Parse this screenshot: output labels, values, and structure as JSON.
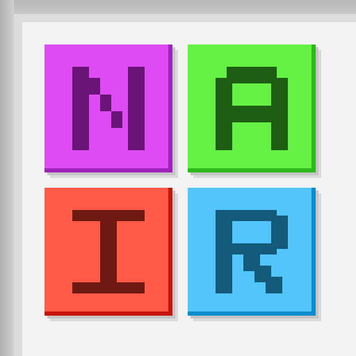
{
  "tiles": [
    {
      "letter": "N",
      "color": "#dc4cf2",
      "edge": "#a022b8",
      "glyph_color": "#6a1478"
    },
    {
      "letter": "A",
      "color": "#66f244",
      "edge": "#2eb81a",
      "glyph_color": "#1d5e14"
    },
    {
      "letter": "I",
      "color": "#ff5a48",
      "edge": "#c8140c",
      "glyph_color": "#6e1a12"
    },
    {
      "letter": "R",
      "color": "#52c6fa",
      "edge": "#0a8ed0",
      "glyph_color": "#145a7a"
    }
  ]
}
